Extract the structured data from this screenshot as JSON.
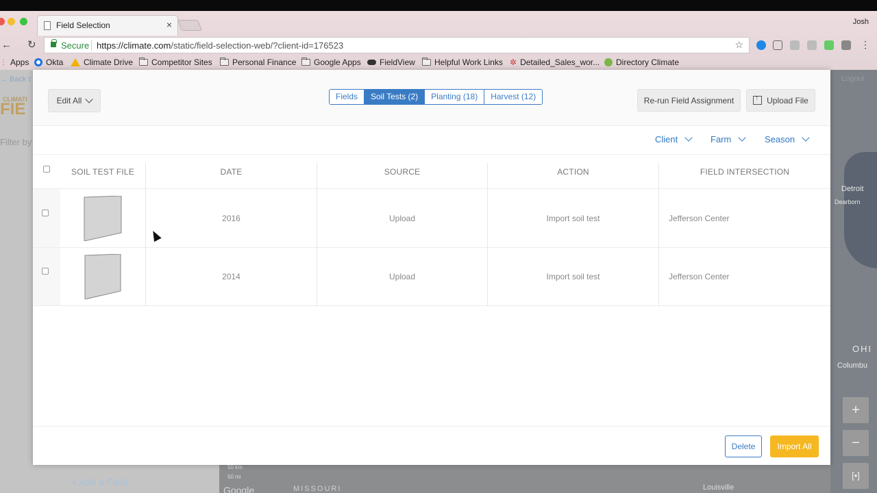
{
  "browser": {
    "tab_title": "Field Selection",
    "tab_close": "×",
    "profile_name": "Josh",
    "secure_label": "Secure",
    "url_domain": "https://climate.com",
    "url_path": "/static/field-selection-web/?client-id=176523",
    "bookmarks": [
      "Apps",
      "Okta",
      "Climate Drive",
      "Competitor Sites",
      "Personal Finance",
      "Google Apps",
      "FieldView",
      "Helpful Work Links",
      "Detailed_Sales_wor...",
      "Directory Climate"
    ]
  },
  "modal": {
    "edit_all": "Edit All",
    "tabs": [
      {
        "label": "Fields"
      },
      {
        "label": "Soil Tests (2)"
      },
      {
        "label": "Planting (18)"
      },
      {
        "label": "Harvest (12)"
      }
    ],
    "active_tab": "Soil Tests (2)",
    "rerun_button": "Re-run Field Assignment",
    "upload_button": "Upload File",
    "filters": [
      {
        "label": "Client"
      },
      {
        "label": "Farm"
      },
      {
        "label": "Season"
      }
    ],
    "columns": [
      "SOIL TEST FILE",
      "DATE",
      "SOURCE",
      "ACTION",
      "FIELD INTERSECTION"
    ],
    "rows": [
      {
        "date": "2016",
        "source": "Upload",
        "action": "Import soil test",
        "field": "Jefferson Center"
      },
      {
        "date": "2014",
        "source": "Upload",
        "action": "Import soil test",
        "field": "Jefferson Center"
      }
    ],
    "delete_button": "Delete",
    "import_button": "Import All"
  },
  "background": {
    "back_link": "← Back t",
    "logo_small": "CLIMATI",
    "logo_big": "FIE",
    "filter_by": "Filter by",
    "logout": "Logout",
    "add_field": "Add a Field",
    "map_labels": [
      "Detroit",
      "Dearborn",
      "OHI",
      "Columbu",
      "Louisville",
      "MISSOURI",
      "Google",
      "50 km",
      "50 mi"
    ],
    "map_zoom_in": "+",
    "map_zoom_out": "−",
    "map_fullscreen": "[•]"
  },
  "colors": {
    "accent": "#3a7cc4",
    "primary_action": "#f5b820",
    "secure": "#2a8a3a"
  }
}
